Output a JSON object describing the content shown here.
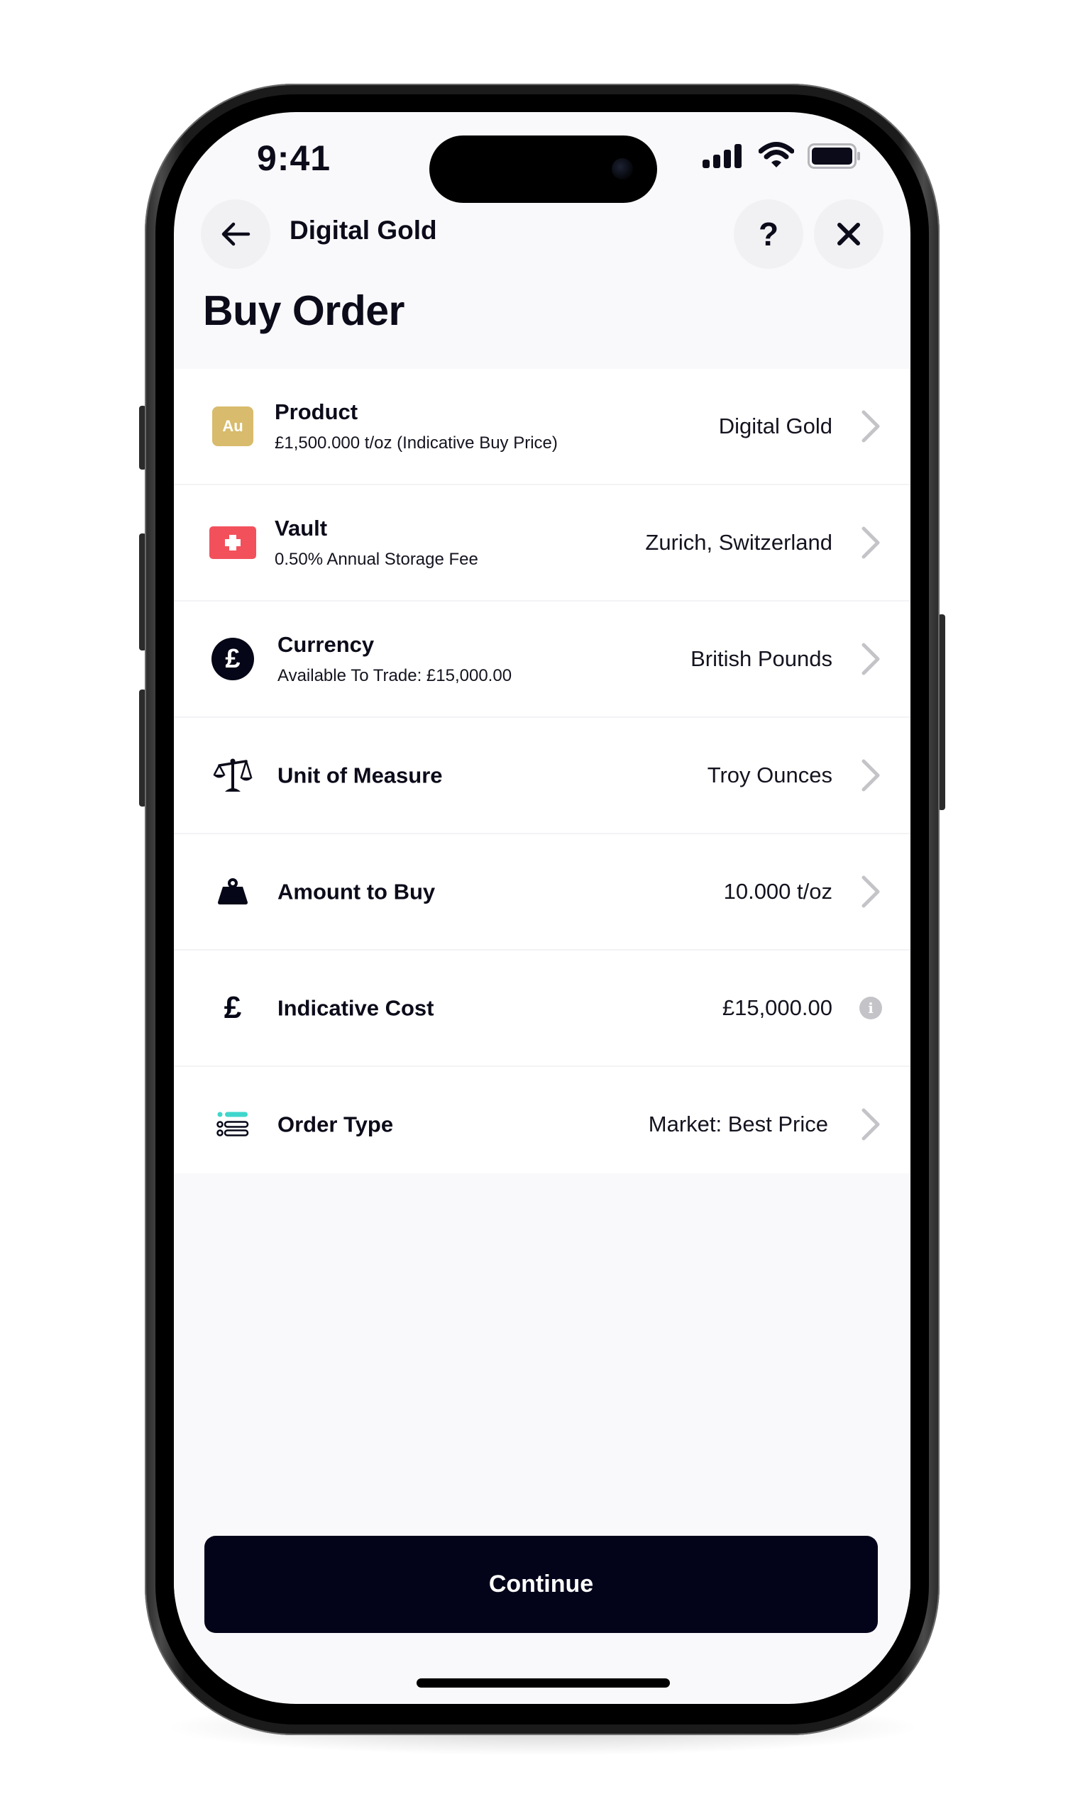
{
  "status_bar": {
    "time": "9:41",
    "icons": [
      "signal-icon",
      "wifi-icon",
      "battery-icon"
    ]
  },
  "nav": {
    "back_icon": "arrow-left-icon",
    "title": "Digital Gold",
    "help_label": "?",
    "close_icon": "close-icon"
  },
  "page": {
    "title": "Buy Order"
  },
  "rows": [
    {
      "icon": "au-badge-icon",
      "icon_text": "Au",
      "title": "Product",
      "subtitle": "£1,500.000 t/oz (Indicative Buy Price)",
      "value": "Digital Gold",
      "trailing": "chevron-right-icon"
    },
    {
      "icon": "swiss-flag-icon",
      "title": "Vault",
      "subtitle": "0.50% Annual Storage Fee",
      "value": "Zurich, Switzerland",
      "trailing": "chevron-right-icon"
    },
    {
      "icon": "pound-circle-icon",
      "icon_text": "£",
      "title": "Currency",
      "subtitle": "Available To Trade: £15,000.00",
      "value": "British Pounds",
      "trailing": "chevron-right-icon"
    },
    {
      "icon": "scales-icon",
      "title": "Unit of Measure",
      "value": "Troy Ounces",
      "trailing": "chevron-right-icon"
    },
    {
      "icon": "weight-icon",
      "title": "Amount to Buy",
      "value": "10.000 t/oz",
      "trailing": "chevron-right-icon"
    },
    {
      "icon": "pound-icon",
      "icon_text": "£",
      "title": "Indicative Cost",
      "value": "£15,000.00",
      "trailing": "info-icon",
      "trailing_text": "i"
    },
    {
      "icon": "order-list-icon",
      "title": "Order Type",
      "value": "Market: Best Price",
      "trailing": "chevron-right-icon"
    }
  ],
  "footer": {
    "continue_label": "Continue"
  },
  "colors": {
    "primary_dark": "#03041a",
    "gold": "#d8bb6c",
    "swiss_red": "#f2515c",
    "teal_accent": "#3fd6cc",
    "chevron_gray": "#c4c4c8",
    "background": "#f9f9fb"
  }
}
